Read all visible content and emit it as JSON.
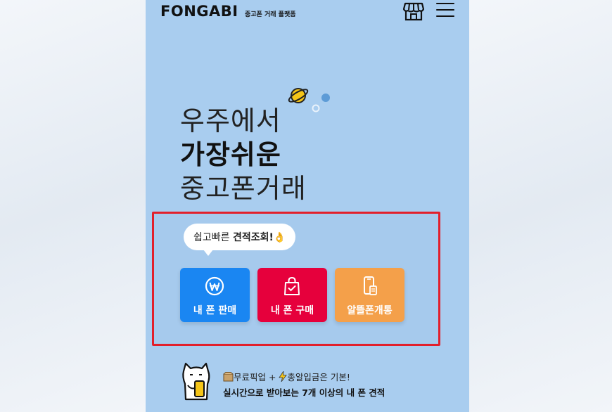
{
  "header": {
    "logo": "FONGABI",
    "tagline": "중고폰 거래 플랫폼",
    "store_icon": "store-icon",
    "menu_icon": "hamburger-menu-icon"
  },
  "hero": {
    "line1": "우주에서",
    "line2": "가장쉬운",
    "line3": "중고폰거래"
  },
  "quote_bubble": {
    "prefix": "쉽고빠른 ",
    "emphasis": "견적조회!",
    "emoji": "👌"
  },
  "cards": [
    {
      "label": "내 폰 판매",
      "icon": "won-coin-icon",
      "color": "#1a86f2"
    },
    {
      "label": "내 폰 구매",
      "icon": "shopping-bag-icon",
      "color": "#e6003c"
    },
    {
      "label": "알뜰폰개통",
      "icon": "phone-sim-icon",
      "color": "#f4a04a"
    }
  ],
  "promo": {
    "box_icon": "box-icon",
    "pickup": "무료픽업 + ",
    "bolt_icon": "lightning-icon",
    "deposit": "총알입금은 기본!",
    "sub": "실시간으로 받아보는 7개 이상의 내 폰 견적"
  },
  "colors": {
    "background": "#a9cdef",
    "highlight_border": "#e21f2b"
  }
}
